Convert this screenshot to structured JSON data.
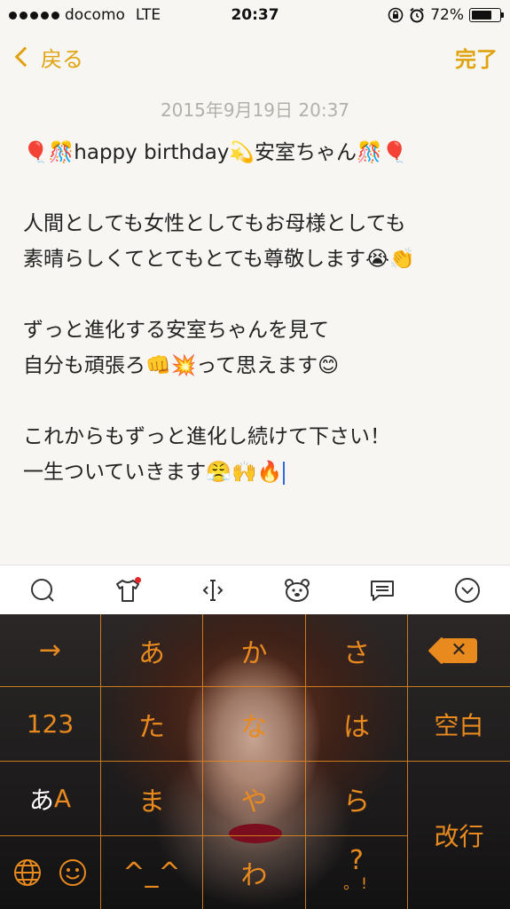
{
  "status_bar": {
    "carrier": "docomo",
    "network": "LTE",
    "time": "20:37",
    "battery_percent": "72%",
    "battery_level": 0.72
  },
  "nav": {
    "back_label": "戻る",
    "done_label": "完了",
    "accent_color": "#e0a30f"
  },
  "note": {
    "date": "2015年9月19日 20:37",
    "lines": [
      "🎈🎊happy birthday💫安室ちゃん🎊🎈",
      "",
      "人間としても女性としてもお母様としても",
      "素晴らしくてとてもとても尊敬します😭👏",
      "",
      "ずっと進化する安室ちゃんを見て",
      "自分も頑張ろ👊💥って思えます😊",
      "",
      "これからもずっと進化し続けて下さい！",
      "一生ついていきます😤🙌🔥"
    ]
  },
  "toolbar": {
    "icons": [
      "search-bubble-icon",
      "tshirt-icon",
      "cursor-move-icon",
      "bear-face-icon",
      "message-icon",
      "chevron-down-circle-icon"
    ]
  },
  "keyboard": {
    "accent_color": "#e98a1f",
    "row1": {
      "arrow": "→",
      "k1": "あ",
      "k2": "か",
      "k3": "さ"
    },
    "row2": {
      "numbers": "123",
      "k1": "た",
      "k2": "な",
      "k3": "は",
      "space": "空白"
    },
    "row3": {
      "mode_jp": "あ",
      "mode_en": "A",
      "k1": "ま",
      "k2": "や",
      "k3": "ら",
      "enter": "改行"
    },
    "row4": {
      "k1": "^_^",
      "k2": "わ",
      "k3_top": "?",
      "k3_bottom": "。!"
    }
  }
}
